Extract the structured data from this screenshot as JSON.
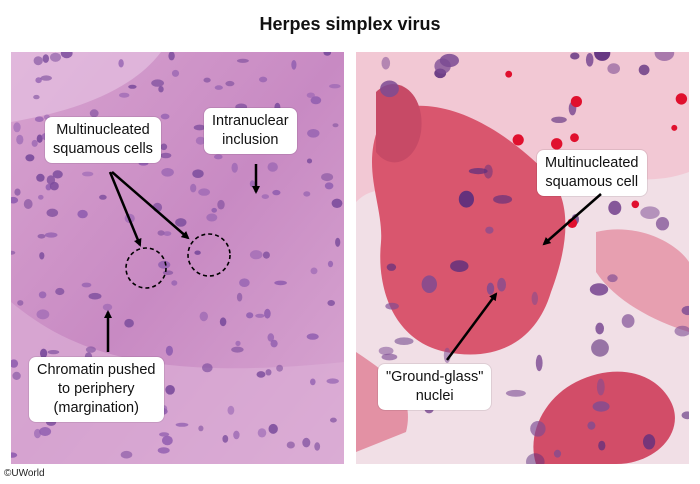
{
  "title": "Herpes simplex virus",
  "left_panel": {
    "label_multinucleated": [
      "Multinucleated",
      "squamous cells"
    ],
    "label_intranuclear": [
      "Intranuclear",
      "inclusion"
    ],
    "label_chromatin": [
      "Chromatin pushed",
      "to periphery",
      "(margination)"
    ]
  },
  "right_panel": {
    "label_multinucleated": [
      "Multinucleated",
      "squamous cell"
    ],
    "label_ground_glass": [
      "\"Ground-glass\"",
      "nuclei"
    ]
  },
  "copyright": "©UWorld",
  "colors": {
    "tissue_left": "#c98bc4",
    "tissue_right": "#d9566e",
    "nucleus": "#6a3c8f",
    "arrow": "#000000"
  }
}
